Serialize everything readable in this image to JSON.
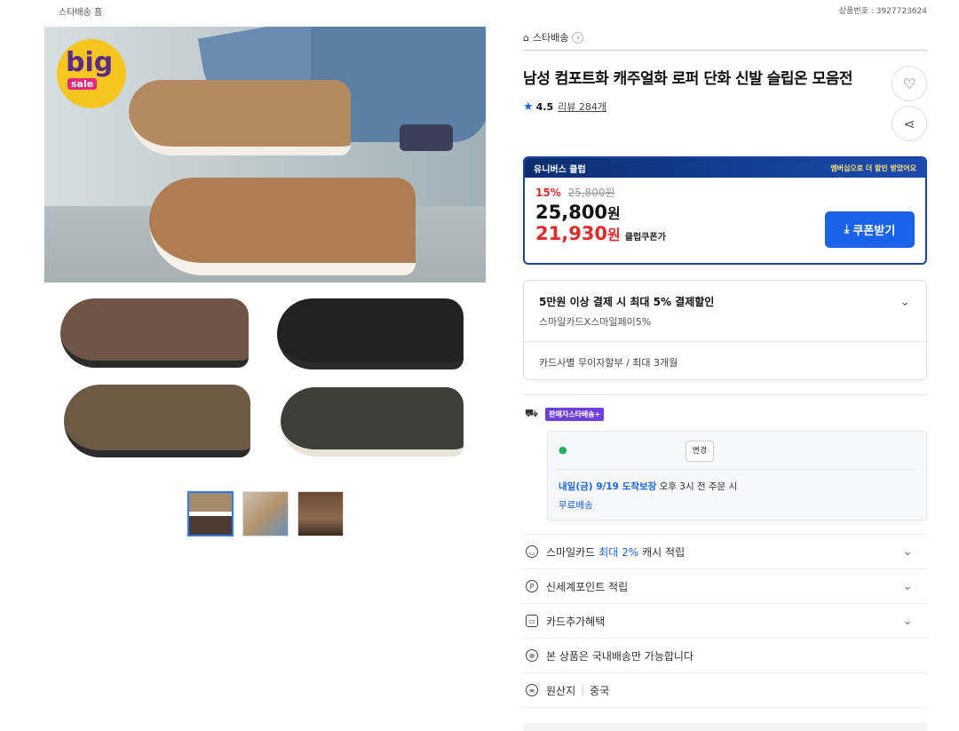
{
  "topbar": {
    "home": "스타배송 홈",
    "product_no": "상품번호 : 3927723624"
  },
  "gallery": {
    "badge_big": "big",
    "badge_sale": "sale",
    "thumbnails": [
      "thumb-1",
      "thumb-2",
      "thumb-3"
    ]
  },
  "product": {
    "store": "스타배송",
    "title": "남성 컴포트화 캐주얼화 로퍼 단화 신발 슬립온 모음전",
    "rating": "4.5",
    "reviews": "리뷰 284개"
  },
  "club": {
    "header_left": "유니버스 클럽",
    "header_right": "멤버십으로 더 할인 받았어요",
    "discount_pct": "15%",
    "old_price": "25,800원",
    "price": "25,800",
    "price_unit": "원",
    "coupon_price": "21,930",
    "coupon_unit": "원",
    "coupon_label": "클럽쿠폰가",
    "coupon_button": "쿠폰받기"
  },
  "payment": {
    "title": "5만원 이상 결제 시 최대 5% 결제할인",
    "subtitle": "스마일카드X스마일페이5%",
    "installment": "카드사별 무이자할부 / 최대 3개월"
  },
  "shipping": {
    "badge": "판매자스타배송+",
    "change_button": "변경",
    "delivery_date": "내일(금) 9/19 도착보장",
    "delivery_cond": "오후 3시 전 주문 시",
    "free": "무료배송"
  },
  "benefits": {
    "smile_pre": "스마일카드",
    "smile_blue": "최대 2%",
    "smile_post": "캐시 적립",
    "ssg": "신세계포인트 적립",
    "card": "카드추가혜택",
    "domestic": "본 상품은 국내배송만 가능합니다",
    "origin_label": "원산지",
    "origin_value": "중국"
  }
}
